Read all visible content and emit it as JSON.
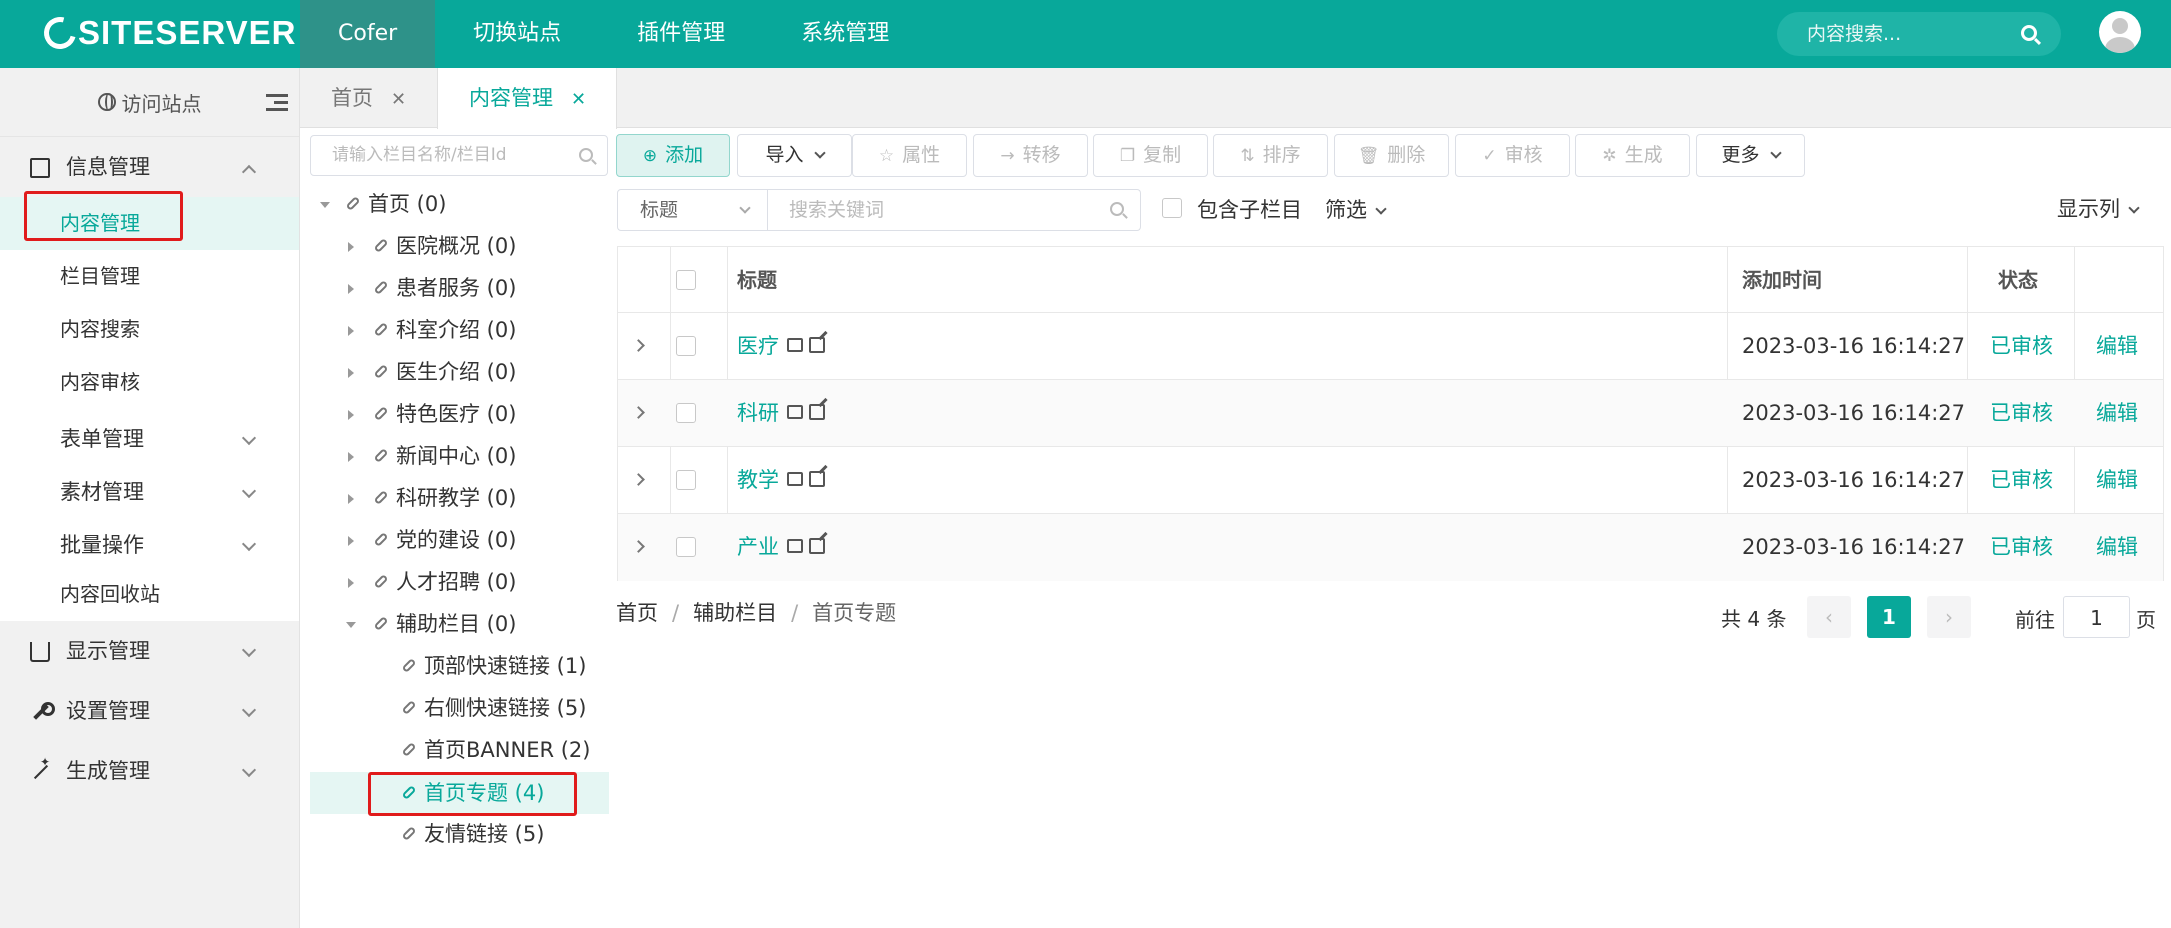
{
  "brand": {
    "name": "SITESERVER",
    "accent": "#08a89a"
  },
  "topnav": {
    "items": [
      {
        "label": "Cofer",
        "active": true
      },
      {
        "label": "切换站点"
      },
      {
        "label": "插件管理"
      },
      {
        "label": "系统管理"
      }
    ],
    "search_placeholder": "内容搜索..."
  },
  "sidebar": {
    "visit_label": "访问站点",
    "groups": [
      {
        "label": "信息管理",
        "icon": "edit-icon",
        "expanded": true,
        "items": [
          "内容管理",
          "栏目管理",
          "内容搜索",
          "内容审核"
        ]
      },
      {
        "label": "表单管理"
      },
      {
        "label": "素材管理"
      },
      {
        "label": "批量操作"
      }
    ],
    "recycle_label": "内容回收站",
    "bottom_groups": [
      {
        "label": "显示管理",
        "icon": "shirt-icon"
      },
      {
        "label": "设置管理",
        "icon": "wrench-icon"
      },
      {
        "label": "生成管理",
        "icon": "magic-wand-icon"
      }
    ]
  },
  "tabs": [
    {
      "label": "首页",
      "close": "✕"
    },
    {
      "label": "内容管理",
      "close": "✕",
      "active": true
    }
  ],
  "tree": {
    "search_placeholder": "请输入栏目名称/栏目Id",
    "nodes": [
      "首页 (0)",
      "医院概况 (0)",
      "患者服务 (0)",
      "科室介绍 (0)",
      "医生介绍 (0)",
      "特色医疗 (0)",
      "新闻中心 (0)",
      "科研教学 (0)",
      "党的建设 (0)",
      "人才招聘 (0)",
      "辅助栏目 (0)",
      "顶部快速链接 (1)",
      "右侧快速链接 (5)",
      "首页BANNER (2)",
      "首页专题 (4)",
      "友情链接 (5)"
    ]
  },
  "toolbar": {
    "add": "添加",
    "import": "导入",
    "attributes": "属性",
    "transfer": "转移",
    "copy": "复制",
    "sort": "排序",
    "delete": "删除",
    "audit": "审核",
    "generate": "生成",
    "more": "更多"
  },
  "filter": {
    "field": "标题",
    "keyword_placeholder": "搜索关键词",
    "include_children": "包含子栏目",
    "filter_label": "筛选",
    "columns_label": "显示列"
  },
  "table": {
    "headers": {
      "title": "标题",
      "added": "添加时间",
      "status": "状态"
    },
    "rows": [
      {
        "title": "医疗",
        "added": "2023-03-16 16:14:27",
        "status": "已审核",
        "action": "编辑"
      },
      {
        "title": "科研",
        "added": "2023-03-16 16:14:27",
        "status": "已审核",
        "action": "编辑"
      },
      {
        "title": "教学",
        "added": "2023-03-16 16:14:27",
        "status": "已审核",
        "action": "编辑"
      },
      {
        "title": "产业",
        "added": "2023-03-16 16:14:27",
        "status": "已审核",
        "action": "编辑"
      }
    ]
  },
  "breadcrumb": [
    "首页",
    "辅助栏目",
    "首页专题"
  ],
  "pagination": {
    "total": "共 4 条",
    "prev": "‹",
    "current": "1",
    "next": "›",
    "goto_label": "前往",
    "goto_value": "1",
    "page_suffix": "页"
  }
}
